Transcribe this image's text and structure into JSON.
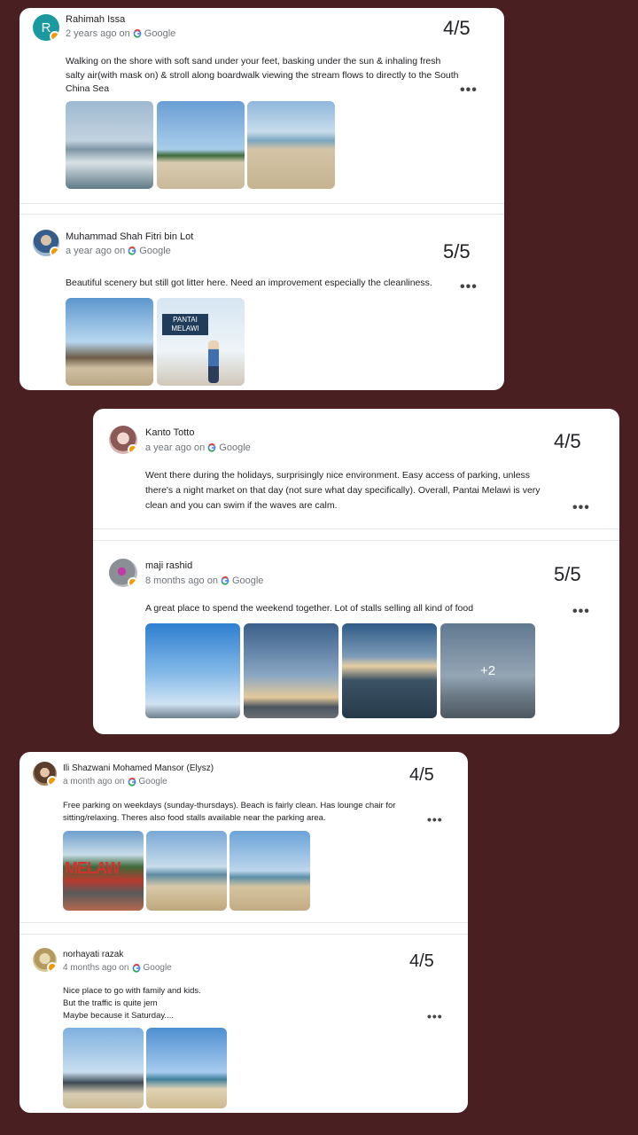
{
  "source_name": "Google",
  "more_label": "•••",
  "reviews": [
    {
      "author": "Rahimah Issa",
      "avatar_letter": "R",
      "time": "2 years ago on",
      "rating": "4/5",
      "text": "Walking on the shore with soft sand under your feet, basking under the sun & inhaling fresh salty air(with mask on) & stroll along boardwalk viewing the stream flows to directly to the South China Sea"
    },
    {
      "author": "Muhammad Shah Fitri bin Lot",
      "time": "a year ago on",
      "rating": "5/5",
      "text": "Beautiful scenery but still got litter here. Need an improvement especially the cleanliness.",
      "photo_sign": "PANTAI MELAWI"
    },
    {
      "author": "Kanto Totto",
      "time": "a year ago on",
      "rating": "4/5",
      "text": "Went there during the holidays, surprisingly nice environment. Easy access of parking, unless there's a night market on that day (not sure what day specifically). Overall, Pantai Melawi is very clean and you can swim if the waves are calm."
    },
    {
      "author": "maji rashid",
      "time": "8 months ago on",
      "rating": "5/5",
      "text": "A great place to spend the weekend together. Lot of stalls selling all kind of food",
      "more_photos": "+2"
    },
    {
      "author": "Ili Shazwani Mohamed Mansor (Elysz)",
      "time": "a month ago on",
      "rating": "4/5",
      "text": "Free parking on weekdays (sunday-thursdays). Beach is fairly clean. Has lounge chair for sitting/relaxing. Theres also food stalls available near the parking area.",
      "photo_sign": "MELAW"
    },
    {
      "author": "norhayati razak",
      "time": "4 months ago on",
      "rating": "4/5",
      "text": "Nice place to go with family and kids.\nBut the traffic is quite jem\nMaybe because it Saturday...."
    }
  ]
}
